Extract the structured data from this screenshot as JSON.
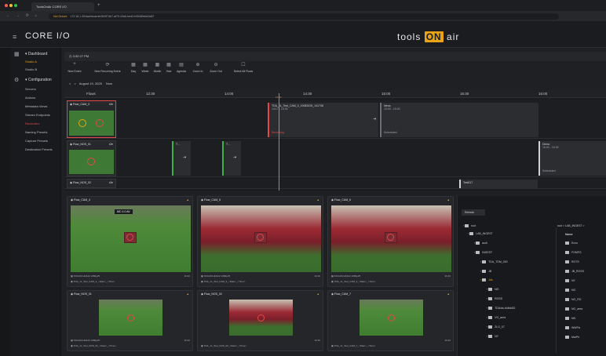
{
  "browser": {
    "tab_title": "ToolsOnAir CORE I/O",
    "new_tab": "+",
    "security": "Not Secure",
    "url": "172.16.1.39/dashboard/e2b0974b7-af79-43a6-bed3-b35489ebb2a87",
    "nav": "← → ⟳ ⌂"
  },
  "app": {
    "logo": "CORE I/O",
    "brand_pre": "tools",
    "brand_on": "ON",
    "brand_post": "air",
    "menu_icon": "≡"
  },
  "sidebar": {
    "dashboard": "Dashboard",
    "dashboard_items": [
      "Studio A",
      "Studio B"
    ],
    "configuration": "Configuration",
    "config_items": [
      "Servers",
      "Actions",
      "Metadata Views",
      "Stream Endpoints",
      "Recorders",
      "Naming Presets",
      "Capture Presets",
      "Destination Presets"
    ]
  },
  "clock": "3:32:27 PM",
  "toolbar": [
    {
      "label": "New Event",
      "icon": "+"
    },
    {
      "label": "New Recurring Event",
      "icon": "⟳"
    },
    {
      "label": "Day",
      "icon": "▦"
    },
    {
      "label": "Week",
      "icon": "▦"
    },
    {
      "label": "Month",
      "icon": "▦"
    },
    {
      "label": "Year",
      "icon": "▦"
    },
    {
      "label": "Agenda",
      "icon": "▤"
    },
    {
      "label": "Zoom In",
      "icon": "⊕"
    },
    {
      "label": "Zoom Out",
      "icon": "⊖"
    },
    {
      "label": "Select All Flows",
      "icon": "☐"
    }
  ],
  "date": {
    "prev": "<",
    "next": ">",
    "label": "August 19, 2025",
    "today": "Now"
  },
  "timeline": {
    "flows_header": "Flows",
    "hours": [
      "12:30",
      "14:00",
      "14:30",
      "15:00",
      "15:30",
      "16:00"
    ],
    "now_marker": "15:32",
    "rows": [
      {
        "name": "Flow_CAM_3",
        "badge": "r2e"
      },
      {
        "name": "Flow_NOS_01",
        "badge": "r2e"
      },
      {
        "name": "Flow_NOS_02",
        "badge": "r2e"
      }
    ],
    "events": {
      "a_title": "TDA_JL_Test_CAM_3_19082025_141708",
      "a_time": "14:17 - 15:30",
      "a_status": "Recording",
      "b_title": "News",
      "b_time": "15:00 - 15:30",
      "b_status": "Scheduled",
      "c_title": "T...",
      "d_title": "T...",
      "e_title": "Demo",
      "e_time": "16:00 - 16:30",
      "e_status": "Scheduled",
      "f_title": "Test017"
    }
  },
  "cards": [
    {
      "name": "Flow_CAM_4",
      "format": "XDCAM HD422 1080p25",
      "tc": "16:40",
      "file": "TDA_JL_Test_CAM_4_<Date>_<Time>"
    },
    {
      "name": "Flow_CAM_5",
      "format": "XDCAM HD422 1080p25",
      "tc": "16:40",
      "file": "TDA_JL_Test_CAM_5_<Date>_<Time>"
    },
    {
      "name": "Flow_CAM_6",
      "format": "XDCAM HD422 1080p25",
      "tc": "16:40",
      "file": "TDA_JL_Test_CAM_6_<Date>_<Time>"
    },
    {
      "name": "Flow_NOS_01",
      "format": "XDCAM HD422 1080p25",
      "tc": "16:40",
      "file": "TDA_JL_Test_NOS_01_<Date>_<Time>"
    },
    {
      "name": "Flow_NOS_02",
      "format": "",
      "tc": "16:40",
      "file": "TDA_JL_Test_NOS_02_<Date>_<Time>"
    },
    {
      "name": "Flow_CAM_7",
      "format": "",
      "tc": "16:40",
      "file": "TDA_JL_Test_CAM_7_<Date>_<Time>"
    }
  ],
  "scoreboard": "MC 0-0 AV",
  "file_browser": {
    "refresh": "Refresh",
    "path": "root > LAB_INGEST >",
    "tree": [
      "root",
      "LAB_INGEST",
      "audi",
      "INGEST",
      "TDA_TOM_000",
      "JB",
      "Jds",
      "NO",
      "ROSS",
      "TDA/ds-bldfdd32",
      "VO_area",
      "ZLG_07",
      "NY"
    ],
    "column_header": "Name",
    "files": [
      "Enzo",
      "FOMFG",
      "ROTS",
      "JB_ROSS",
      "NY",
      "NO",
      "NO_RG",
      "NO_area",
      "NN",
      "WWFic",
      "MarPri"
    ]
  },
  "colors": {
    "accent": "#e8a317",
    "record": "#e24848",
    "progress": "#3fb04a"
  }
}
